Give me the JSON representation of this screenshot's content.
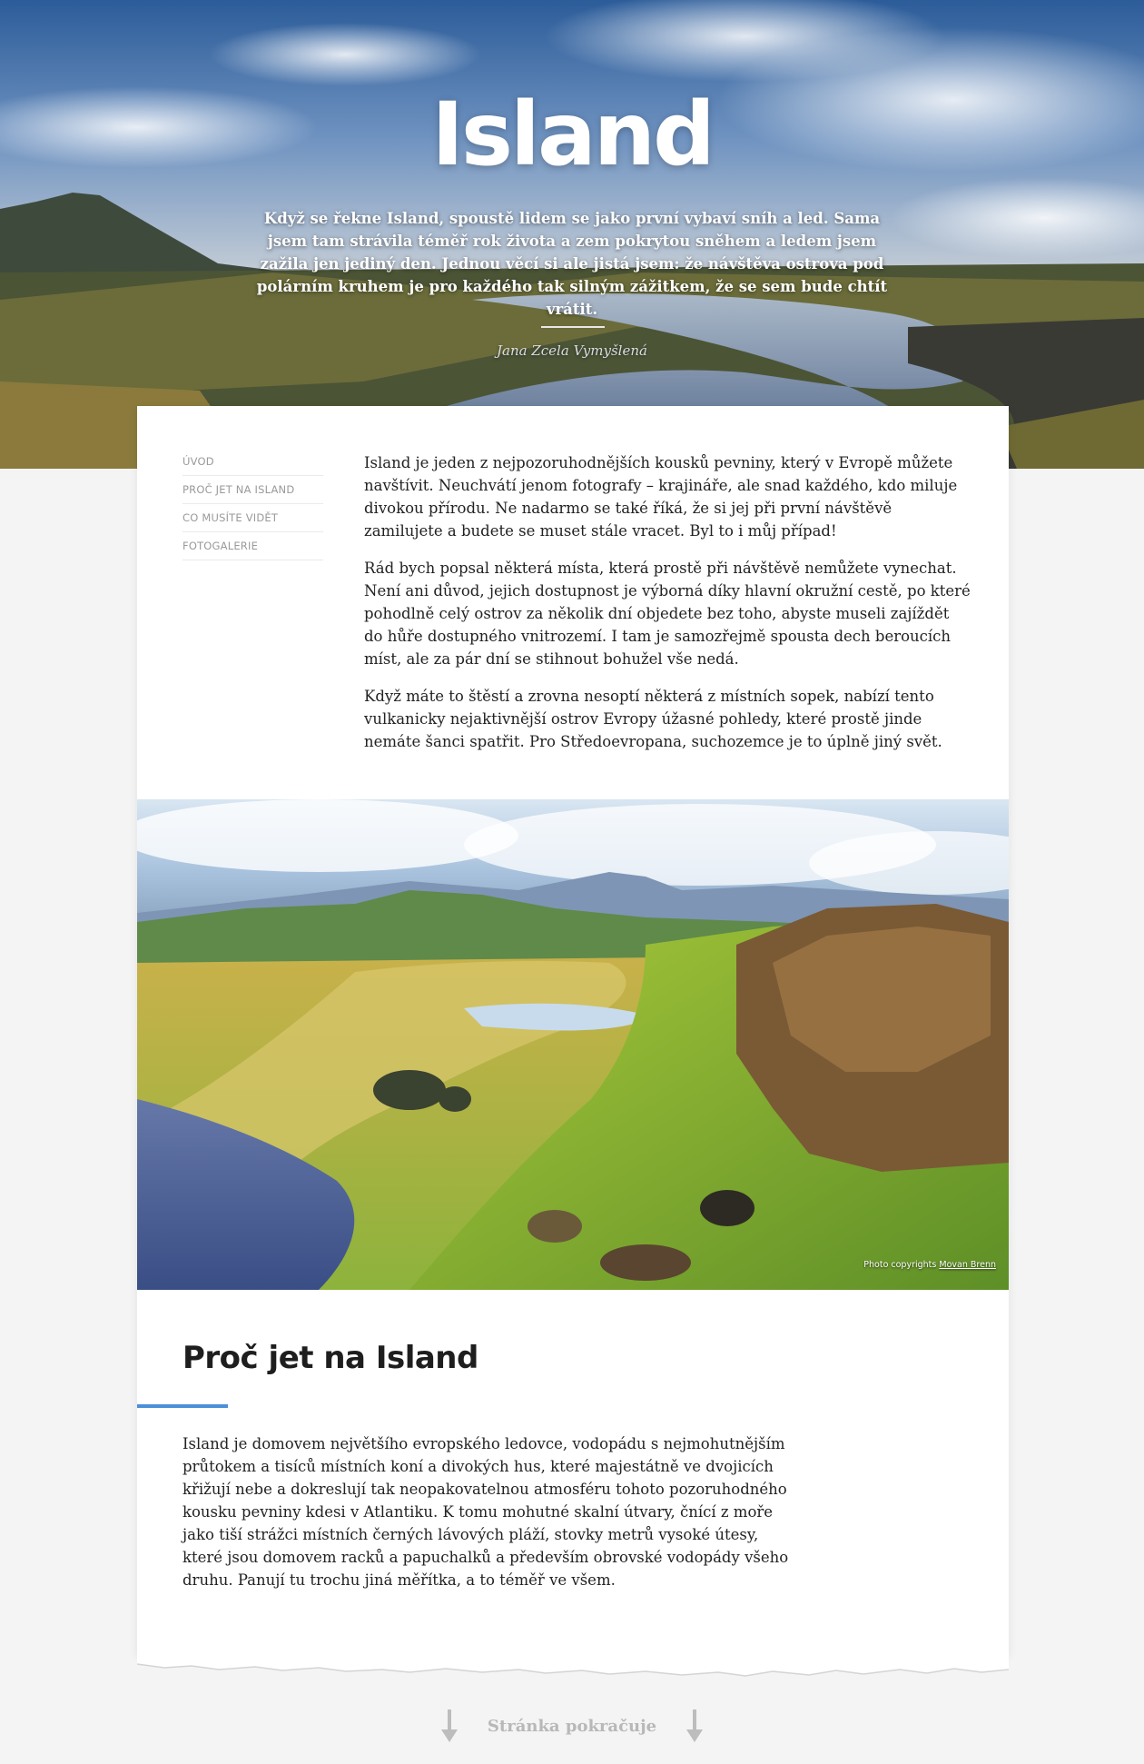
{
  "hero": {
    "title": "Island",
    "intro": "Když se řekne Island, spoustě lidem se jako první vybaví sníh a led. Sama jsem tam strávila téměř rok života a zem pokrytou sněhem a ledem jsem zažila jen jediný den. Jednou věcí si ale jistá jsem: že návštěva ostrova pod polárním kruhem je pro každého tak silným zážitkem, že se sem bude chtít vrátit.",
    "author": "Jana Zcela Vymyšlená"
  },
  "toc": {
    "items": [
      {
        "label": "Úvod"
      },
      {
        "label": "Proč jet na Island"
      },
      {
        "label": "Co musíte vidět"
      },
      {
        "label": "Fotogalerie"
      }
    ]
  },
  "intro": {
    "paragraphs": [
      "Island je jeden z nejpozoruhodnějších kousků pevniny, který v Evropě můžete navštívit. Neuchvátí jenom fotografy – krajináře, ale snad každého, kdo miluje divokou přírodu. Ne nadarmo se také říká, že si jej při první návštěvě zamilujete a budete se muset stále vracet. Byl to i můj případ!",
      "Rád bych popsal některá místa, která prostě při návštěvě nemůžete vynechat. Není ani důvod, jejich dostupnost je výborná díky hlavní okružní cestě, po které pohodlně celý ostrov za několik dní objedete bez toho, abyste museli zajíždět do hůře dostupného vnitrozemí. I tam je samozřejmě spousta dech beroucích míst, ale za pár dní se stihnout bohužel vše nedá.",
      "Když máte to štěstí a zrovna nesoptí některá z místních sopek, nabízí tento vulkanicky nejaktivnější ostrov Evropy úžasné pohledy, které prostě jinde nemáte šanci spatřit. Pro Středoevropana, suchozemce je to úplně jiný svět."
    ]
  },
  "photo": {
    "credit_prefix": "Photo copyrights",
    "credit_author": "Movan Brenn"
  },
  "section": {
    "title": "Proč jet na Island",
    "text": "Island je domovem největšího evropského ledovce, vodopádu s nejmohutnějším průtokem a tisíců místních koní a divokých hus, které majestátně ve dvojicích křižují nebe a dokreslují tak neopakovatelnou atmosféru tohoto pozoruhodného kousku pevniny kdesi v Atlantiku. K tomu mohutné skalní útvary, čnící z moře jako tiší strážci místních černých lávových pláží, stovky metrů vysoké útesy, které jsou domovem racků a papuchalků a především obrovské vodopády všeho druhu. Panují tu trochu jiná měřítka, a to téměř ve všem.",
    "accent_color": "#4a8fd8"
  },
  "footer": {
    "continue_label": "Stránka pokračuje",
    "arrow_icon": "arrow-down-icon"
  }
}
